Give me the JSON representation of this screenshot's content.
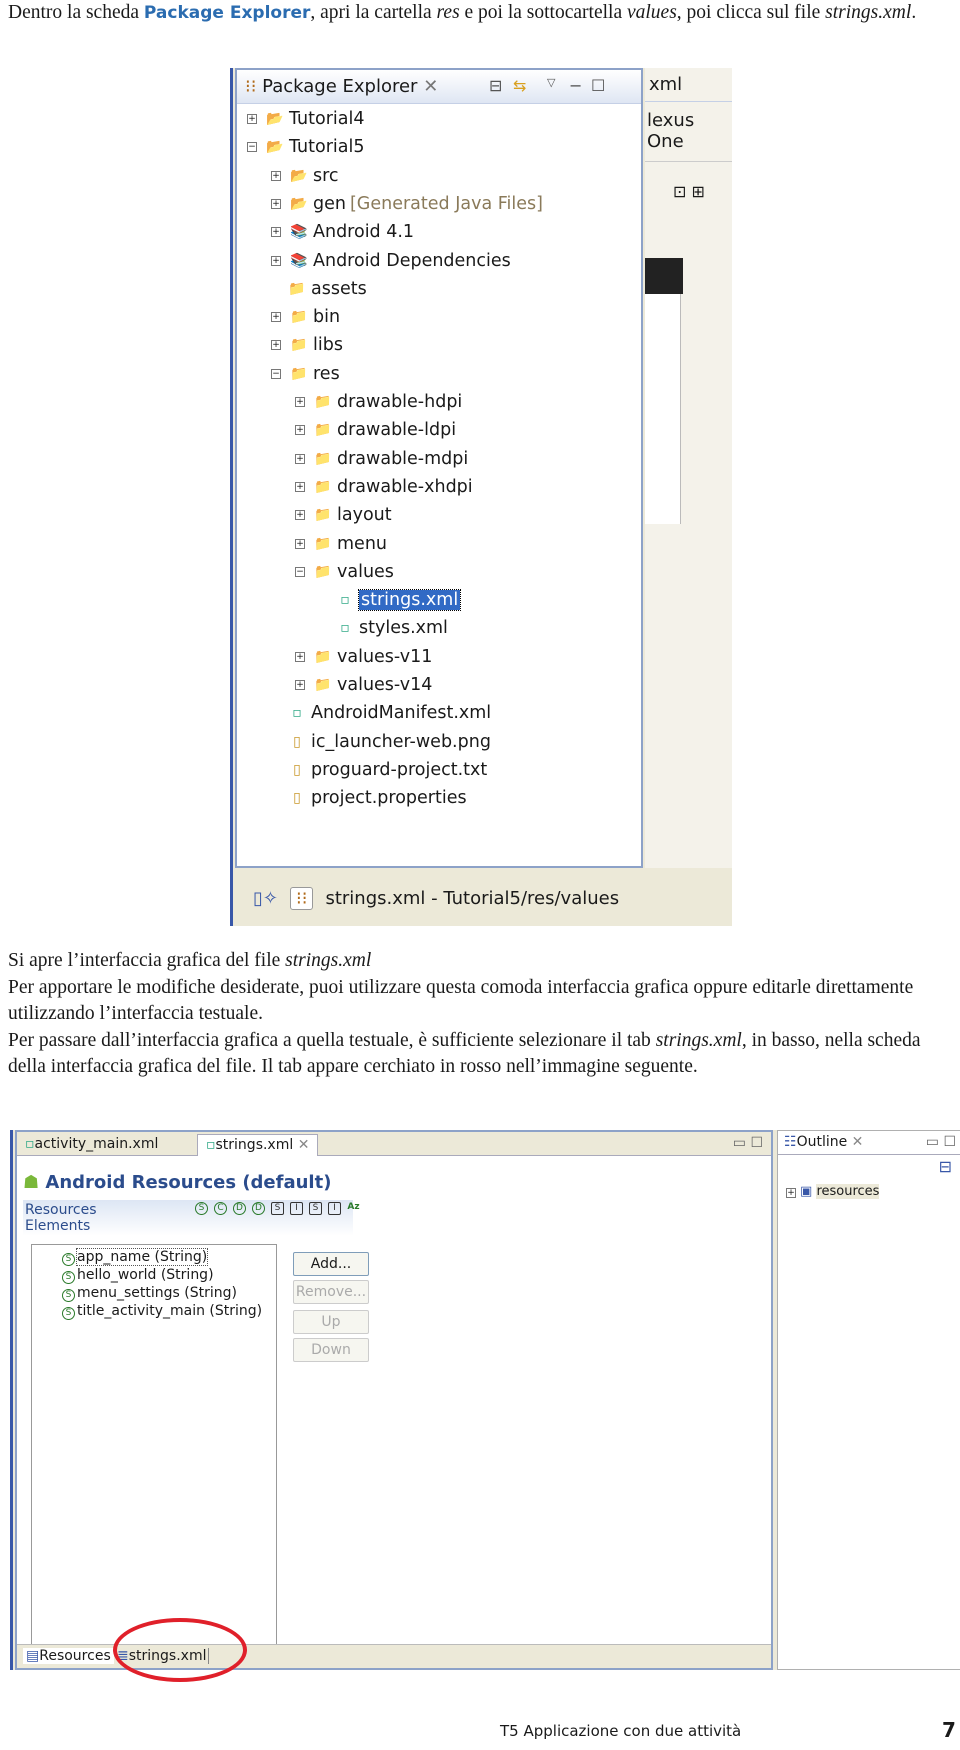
{
  "intro": {
    "t1": "Dentro la scheda ",
    "t2": "Package Explorer",
    "t3": ", apri la cartella ",
    "t4": "res",
    "t5": " e poi la sottocartella ",
    "t6": "values",
    "t7": ", poi clicca sul file ",
    "t8": "strings.xml",
    "t9": "."
  },
  "package_explorer": {
    "title": "Package Explorer",
    "editor_tab_partial": "xml",
    "device_partial": "lexus One",
    "tree": [
      {
        "label": "Tutorial4",
        "level": 0,
        "exp": "+",
        "icon": "project"
      },
      {
        "label": "Tutorial5",
        "level": 0,
        "exp": "-",
        "icon": "project"
      },
      {
        "label": "src",
        "level": 1,
        "exp": "+",
        "icon": "package-folder"
      },
      {
        "label": "gen",
        "suffix": "[Generated Java Files]",
        "level": 1,
        "exp": "+",
        "icon": "package-folder"
      },
      {
        "label": "Android 4.1",
        "level": 1,
        "exp": "+",
        "icon": "library"
      },
      {
        "label": "Android Dependencies",
        "level": 1,
        "exp": "+",
        "icon": "library"
      },
      {
        "label": "assets",
        "level": 1,
        "exp": "",
        "icon": "folder"
      },
      {
        "label": "bin",
        "level": 1,
        "exp": "+",
        "icon": "folder"
      },
      {
        "label": "libs",
        "level": 1,
        "exp": "+",
        "icon": "folder"
      },
      {
        "label": "res",
        "level": 1,
        "exp": "-",
        "icon": "folder"
      },
      {
        "label": "drawable-hdpi",
        "level": 2,
        "exp": "+",
        "icon": "folder"
      },
      {
        "label": "drawable-ldpi",
        "level": 2,
        "exp": "+",
        "icon": "folder"
      },
      {
        "label": "drawable-mdpi",
        "level": 2,
        "exp": "+",
        "icon": "folder"
      },
      {
        "label": "drawable-xhdpi",
        "level": 2,
        "exp": "+",
        "icon": "folder"
      },
      {
        "label": "layout",
        "level": 2,
        "exp": "+",
        "icon": "folder"
      },
      {
        "label": "menu",
        "level": 2,
        "exp": "+",
        "icon": "folder"
      },
      {
        "label": "values",
        "level": 2,
        "exp": "-",
        "icon": "folder"
      },
      {
        "label": "strings.xml",
        "level": 3,
        "exp": "",
        "icon": "xml-file",
        "selected": true
      },
      {
        "label": "styles.xml",
        "level": 3,
        "exp": "",
        "icon": "xml-file"
      },
      {
        "label": "values-v11",
        "level": 2,
        "exp": "+",
        "icon": "folder"
      },
      {
        "label": "values-v14",
        "level": 2,
        "exp": "+",
        "icon": "folder"
      },
      {
        "label": "AndroidManifest.xml",
        "level": 1,
        "exp": "",
        "icon": "xml-file"
      },
      {
        "label": "ic_launcher-web.png",
        "level": 1,
        "exp": "",
        "icon": "file"
      },
      {
        "label": "proguard-project.txt",
        "level": 1,
        "exp": "",
        "icon": "file"
      },
      {
        "label": "project.properties",
        "level": 1,
        "exp": "",
        "icon": "file"
      }
    ],
    "status": "strings.xml - Tutorial5/res/values"
  },
  "para": {
    "a1": "Si apre l’interfaccia grafica del file ",
    "a2": "strings.xml",
    ".": ".",
    "b": "Per apportare le modifiche desiderate, puoi utilizzare questa comoda interfaccia grafica oppure editarle direttamente utilizzando l’interfaccia testuale.",
    "c1": "Per passare dall’interfaccia grafica a quella testuale, è sufficiente selezionare il tab ",
    "c2": "strings.xml",
    "c3": ", in basso, nella scheda della interfaccia grafica del file. Il tab appare cerchiato in rosso nell’immagine seguente."
  },
  "editor": {
    "tabs": [
      "activity_main.xml",
      "strings.xml"
    ],
    "title": "Android Resources (default)",
    "section1": "Resources",
    "section2": "Elements",
    "filter_icons": [
      "S",
      "C",
      "D",
      "D",
      "S",
      "I",
      "S",
      "I",
      "Az"
    ],
    "items": [
      "app_name (String)",
      "hello_world (String)",
      "menu_settings (String)",
      "title_activity_main (String)"
    ],
    "buttons": {
      "add": "Add...",
      "remove": "Remove...",
      "up": "Up",
      "down": "Down"
    },
    "bottom_tabs": [
      "Resources",
      "strings.xml"
    ],
    "highlight_color": "#e0202a"
  },
  "outline": {
    "title": "Outline",
    "item": "resources"
  },
  "footer": {
    "chapter": "T5  Applicazione con due attività",
    "page": "7"
  }
}
